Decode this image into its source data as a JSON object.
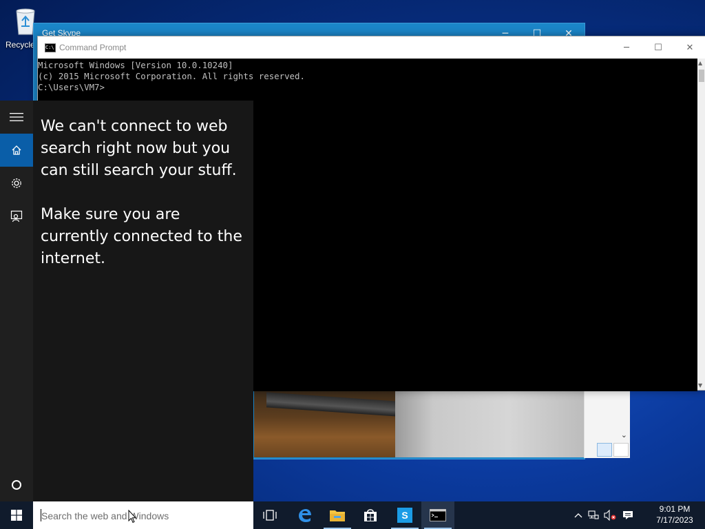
{
  "desktop": {
    "recycle_bin_label": "Recycle"
  },
  "skype_window": {
    "title": "Get Skype",
    "minimize": "─",
    "maximize": "☐",
    "close": "✕"
  },
  "cmd_window": {
    "title": "Command Prompt",
    "icon_text": "C:\\",
    "minimize": "─",
    "maximize": "☐",
    "close": "✕",
    "lines": [
      "Microsoft Windows [Version 10.0.10240]",
      "(c) 2015 Microsoft Corporation. All rights reserved.",
      "",
      "C:\\Users\\VM7>"
    ]
  },
  "cortana": {
    "rail": [
      "hamburger-menu-icon",
      "home-icon",
      "settings-gear-icon",
      "feedback-icon",
      "cortana-circle-icon"
    ],
    "message_1": "We can't connect to web search right now but you can still search your stuff.",
    "message_2": "Make sure you are currently connected to the internet."
  },
  "taskbar": {
    "search_placeholder": "Search the web and Windows",
    "apps": [
      "task-view-icon",
      "edge-icon",
      "file-explorer-icon",
      "store-icon",
      "skype-icon",
      "command-prompt-icon"
    ],
    "clock_time": "9:01 PM",
    "clock_date": "7/17/2023"
  },
  "colors": {
    "accent": "#0a5ea8",
    "skype_blue": "#1b86c9",
    "taskbar": "#101b2c"
  }
}
